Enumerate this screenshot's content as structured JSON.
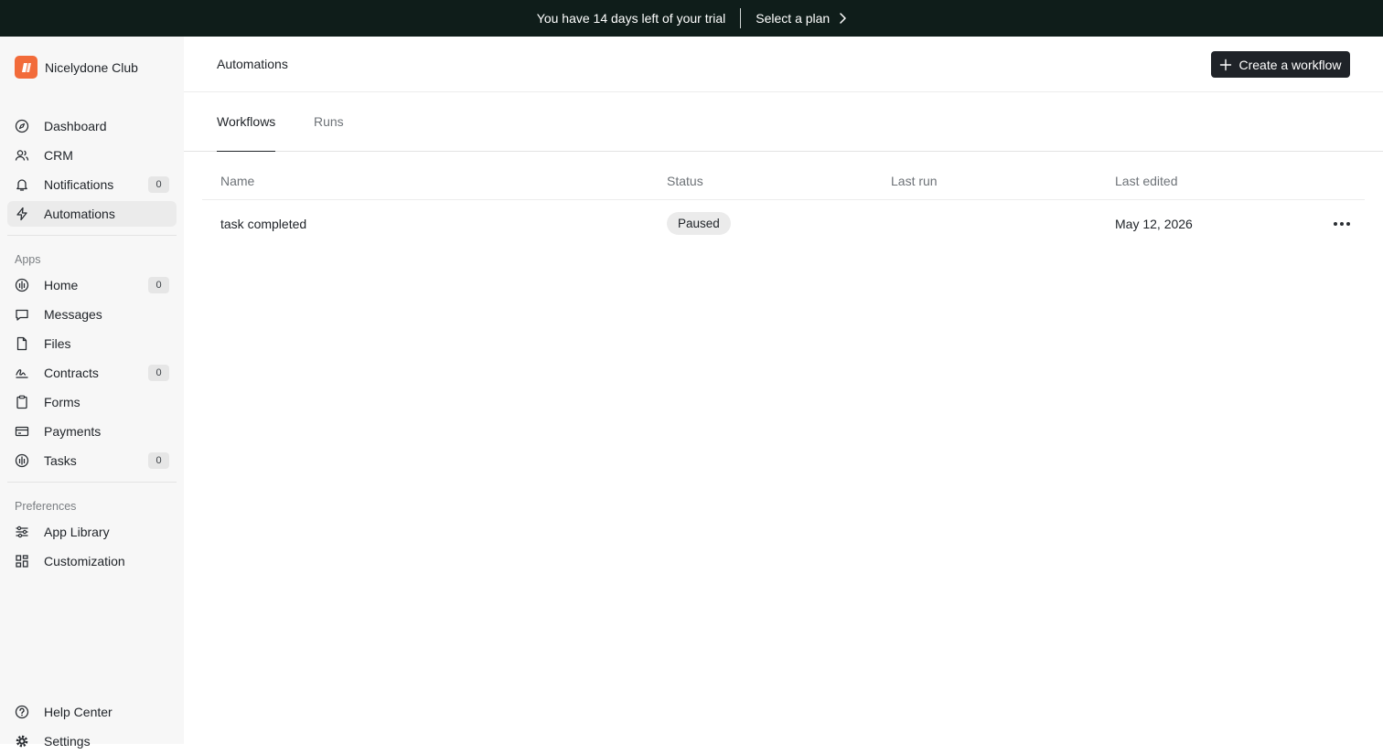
{
  "banner": {
    "message": "You have 14 days left of your trial",
    "cta": "Select a plan"
  },
  "brand": {
    "name": "Nicelydone Club",
    "logo_color": "#f26b3a"
  },
  "sidebar": {
    "main": [
      {
        "label": "Dashboard",
        "icon": "compass-icon"
      },
      {
        "label": "CRM",
        "icon": "users-icon"
      },
      {
        "label": "Notifications",
        "icon": "bell-icon",
        "badge": "0"
      },
      {
        "label": "Automations",
        "icon": "bolt-icon",
        "active": true
      }
    ],
    "apps_label": "Apps",
    "apps": [
      {
        "label": "Home",
        "icon": "home-icon",
        "badge": "0"
      },
      {
        "label": "Messages",
        "icon": "message-icon"
      },
      {
        "label": "Files",
        "icon": "file-icon"
      },
      {
        "label": "Contracts",
        "icon": "signature-icon",
        "badge": "0"
      },
      {
        "label": "Forms",
        "icon": "clipboard-icon"
      },
      {
        "label": "Payments",
        "icon": "credit-card-icon"
      },
      {
        "label": "Tasks",
        "icon": "tasks-icon",
        "badge": "0"
      }
    ],
    "preferences_label": "Preferences",
    "preferences": [
      {
        "label": "App Library",
        "icon": "sliders-icon"
      },
      {
        "label": "Customization",
        "icon": "grid-icon"
      }
    ],
    "footer": [
      {
        "label": "Help Center",
        "icon": "help-icon"
      },
      {
        "label": "Settings",
        "icon": "gear-icon"
      }
    ]
  },
  "header": {
    "title": "Automations",
    "create_label": "Create a workflow"
  },
  "tabs": [
    {
      "label": "Workflows",
      "active": true
    },
    {
      "label": "Runs",
      "active": false
    }
  ],
  "table": {
    "columns": [
      "Name",
      "Status",
      "Last run",
      "Last edited"
    ],
    "rows": [
      {
        "name": "task completed",
        "status": "Paused",
        "last_run": "",
        "last_edited": "May 12, 2026"
      }
    ]
  }
}
